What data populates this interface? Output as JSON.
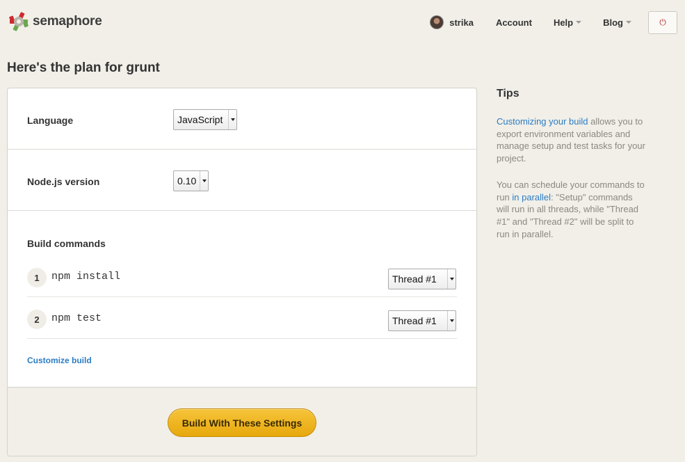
{
  "header": {
    "logo_text": "semaphore",
    "user_name": "strika",
    "nav": {
      "account": "Account",
      "help": "Help",
      "blog": "Blog"
    },
    "power_icon": "⏻"
  },
  "page": {
    "title": "Here's the plan for grunt"
  },
  "settings": {
    "language": {
      "label": "Language",
      "value": "JavaScript"
    },
    "node_version": {
      "label": "Node.js version",
      "value": "0.10"
    },
    "build": {
      "label": "Build commands",
      "commands": [
        {
          "number": "1",
          "command": "npm install",
          "thread": "Thread #1"
        },
        {
          "number": "2",
          "command": "npm test",
          "thread": "Thread #1"
        }
      ],
      "customize_link": "Customize build"
    },
    "submit_label": "Build With These Settings"
  },
  "tips": {
    "title": "Tips",
    "p1_link": "Customizing your build",
    "p1_text": " allows you to export environment variables and manage setup and test tasks for your project.",
    "p2_before": "You can schedule your commands to run ",
    "p2_link": "in parallel",
    "p2_after": ": \"Setup\" commands will run in all threads, while \"Thread #1\" and \"Thread #2\" will be split to run in parallel."
  },
  "colors": {
    "accent": "#2b7cc4",
    "button": "#f0b51f",
    "background": "#f1efe8",
    "logo_red": "#d0282e",
    "logo_green": "#6aa84f"
  }
}
